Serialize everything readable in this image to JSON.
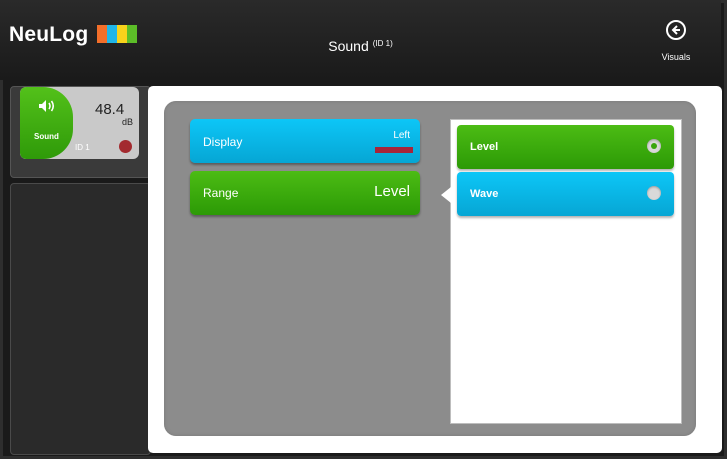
{
  "header": {
    "logo_text": "NeuLog",
    "logo_colors": [
      "#f36f2a",
      "#1fb6e8",
      "#f7d21b",
      "#5cbd28"
    ],
    "title": "Sound",
    "title_id": "(ID 1)",
    "back_icon": "circle-arrow-left-icon",
    "back_label": "Visuals"
  },
  "sensor": {
    "icon": "speaker-icon",
    "name": "Sound",
    "value": "48.4",
    "unit": "dB",
    "id": "ID 1",
    "color_bg": "#c9c9c9",
    "color_active": "#3aa50e",
    "record_color": "#a32a2f"
  },
  "settings": {
    "display": {
      "label": "Display",
      "value": "Left",
      "swatch_color": "#a8253a"
    },
    "range": {
      "label": "Range",
      "value": "Level"
    }
  },
  "options": [
    {
      "label": "Level",
      "selected": true
    },
    {
      "label": "Wave",
      "selected": false
    }
  ],
  "colors": {
    "blue": "#06a6d4",
    "green": "#2c9a06"
  }
}
